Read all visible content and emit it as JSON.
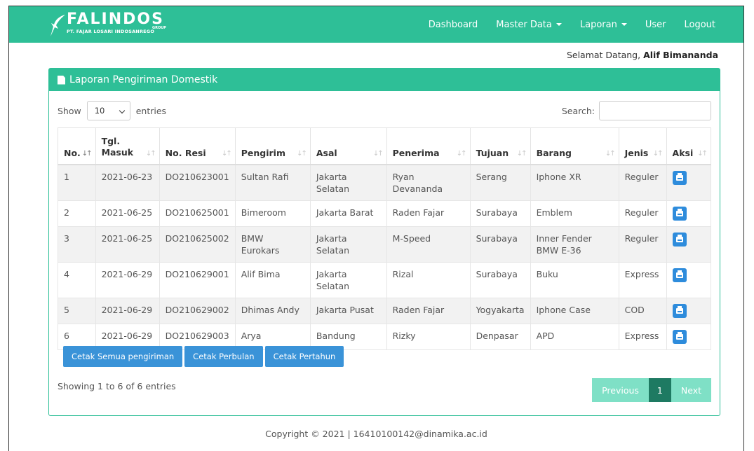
{
  "brand": {
    "name": "FALINDOS",
    "group": "GROUP",
    "company": "PT. FAJAR LOSARI INDOSANREGO"
  },
  "nav": {
    "items": [
      {
        "label": "Dashboard",
        "dropdown": false
      },
      {
        "label": "Master Data",
        "dropdown": true
      },
      {
        "label": "Laporan",
        "dropdown": true
      },
      {
        "label": "User",
        "dropdown": false
      },
      {
        "label": "Logout",
        "dropdown": false
      }
    ]
  },
  "welcome": {
    "prefix": "Selamat Datang,",
    "user": "Alif Bimananda"
  },
  "card": {
    "title": "Laporan Pengiriman Domestik"
  },
  "length": {
    "show": "Show",
    "value": "10",
    "entries": "entries"
  },
  "search": {
    "label": "Search:",
    "value": ""
  },
  "table": {
    "headers": [
      "No.",
      "Tgl. Masuk",
      "No. Resi",
      "Pengirim",
      "Asal",
      "Penerima",
      "Tujuan",
      "Barang",
      "Jenis",
      "Aksi"
    ],
    "rows": [
      [
        "1",
        "2021-06-23",
        "DO210623001",
        "Sultan Rafi",
        "Jakarta Selatan",
        "Ryan Devananda",
        "Serang",
        "Iphone XR",
        "Reguler"
      ],
      [
        "2",
        "2021-06-25",
        "DO210625001",
        "Bimeroom",
        "Jakarta Barat",
        "Raden Fajar",
        "Surabaya",
        "Emblem",
        "Reguler"
      ],
      [
        "3",
        "2021-06-25",
        "DO210625002",
        "BMW Eurokars",
        "Jakarta Selatan",
        "M-Speed",
        "Surabaya",
        "Inner Fender BMW E-36",
        "Reguler"
      ],
      [
        "4",
        "2021-06-29",
        "DO210629001",
        "Alif Bima",
        "Jakarta Selatan",
        "Rizal",
        "Surabaya",
        "Buku",
        "Express"
      ],
      [
        "5",
        "2021-06-29",
        "DO210629002",
        "Dhimas Andy",
        "Jakarta Pusat",
        "Raden Fajar",
        "Yogyakarta",
        "Iphone Case",
        "COD"
      ],
      [
        "6",
        "2021-06-29",
        "DO210629003",
        "Arya",
        "Bandung",
        "Rizky",
        "Denpasar",
        "APD",
        "Express"
      ]
    ]
  },
  "buttons": {
    "all": "Cetak Semua pengiriman",
    "monthly": "Cetak Perbulan",
    "yearly": "Cetak Pertahun"
  },
  "info": "Showing 1 to 6 of 6 entries",
  "pagination": {
    "previous": "Previous",
    "current": "1",
    "next": "Next"
  },
  "footer": "Copyright © 2021 | 16410100142@dinamika.ac.id",
  "colors": {
    "primary": "#2ebf97",
    "button": "#3a93d8",
    "page_active": "#1e7a62",
    "page_disabled": "#7fe0c6"
  }
}
